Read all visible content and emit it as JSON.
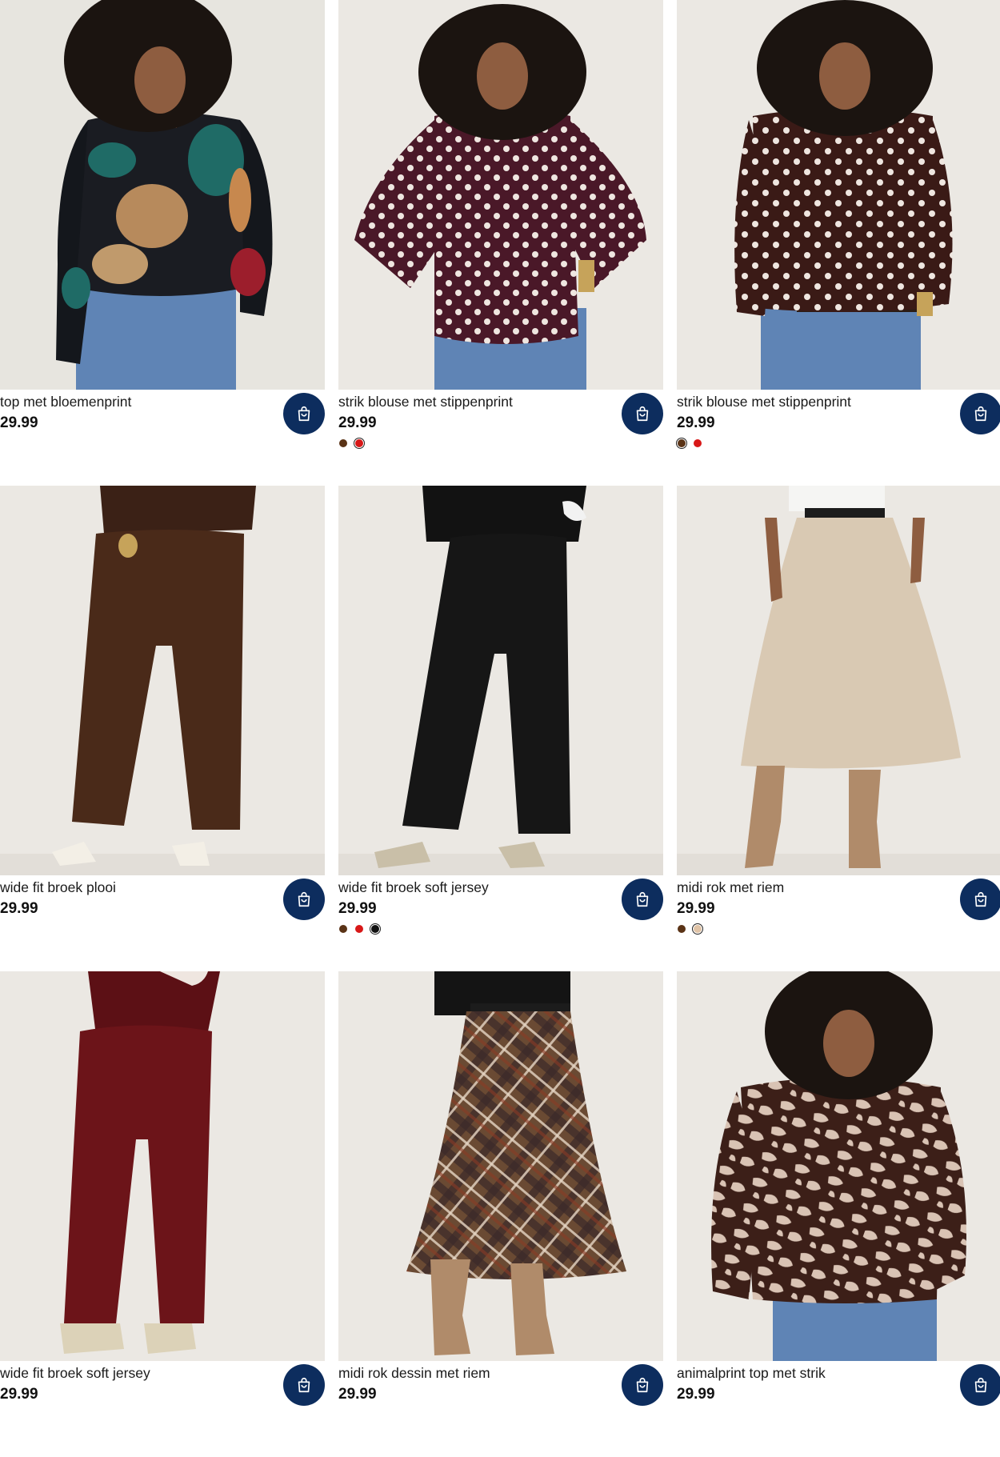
{
  "colors": {
    "cart_button": "#0d2d5e",
    "photo_background": "#e9e6e2"
  },
  "products": [
    {
      "name": "top met bloemenprint",
      "price": "29.99",
      "garment": "floral-top",
      "swatches": []
    },
    {
      "name": "strik blouse met stippenprint",
      "price": "29.99",
      "garment": "polka-blouse-burgundy",
      "swatches": [
        {
          "color": "#5a3316",
          "selected": false
        },
        {
          "color": "#d81818",
          "selected": true
        }
      ]
    },
    {
      "name": "strik blouse met stippenprint",
      "price": "29.99",
      "garment": "polka-blouse-brown",
      "swatches": [
        {
          "color": "#5a3316",
          "selected": true
        },
        {
          "color": "#d81818",
          "selected": false
        }
      ]
    },
    {
      "name": "wide fit broek plooi",
      "price": "29.99",
      "garment": "brown-trousers",
      "swatches": []
    },
    {
      "name": "wide fit broek soft jersey",
      "price": "29.99",
      "garment": "black-trousers",
      "swatches": [
        {
          "color": "#5a3316",
          "selected": false
        },
        {
          "color": "#d81818",
          "selected": false
        },
        {
          "color": "#111111",
          "selected": true
        }
      ]
    },
    {
      "name": "midi rok met riem",
      "price": "29.99",
      "garment": "beige-skirt",
      "swatches": [
        {
          "color": "#5a3316",
          "selected": false
        },
        {
          "color": "#e0c3a6",
          "selected": true
        }
      ]
    },
    {
      "name": "wide fit broek soft jersey",
      "price": "29.99",
      "garment": "burgundy-trousers",
      "swatches": []
    },
    {
      "name": "midi rok dessin met riem",
      "price": "29.99",
      "garment": "plaid-skirt",
      "swatches": []
    },
    {
      "name": "animalprint top met strik",
      "price": "29.99",
      "garment": "animal-top",
      "swatches": []
    }
  ]
}
